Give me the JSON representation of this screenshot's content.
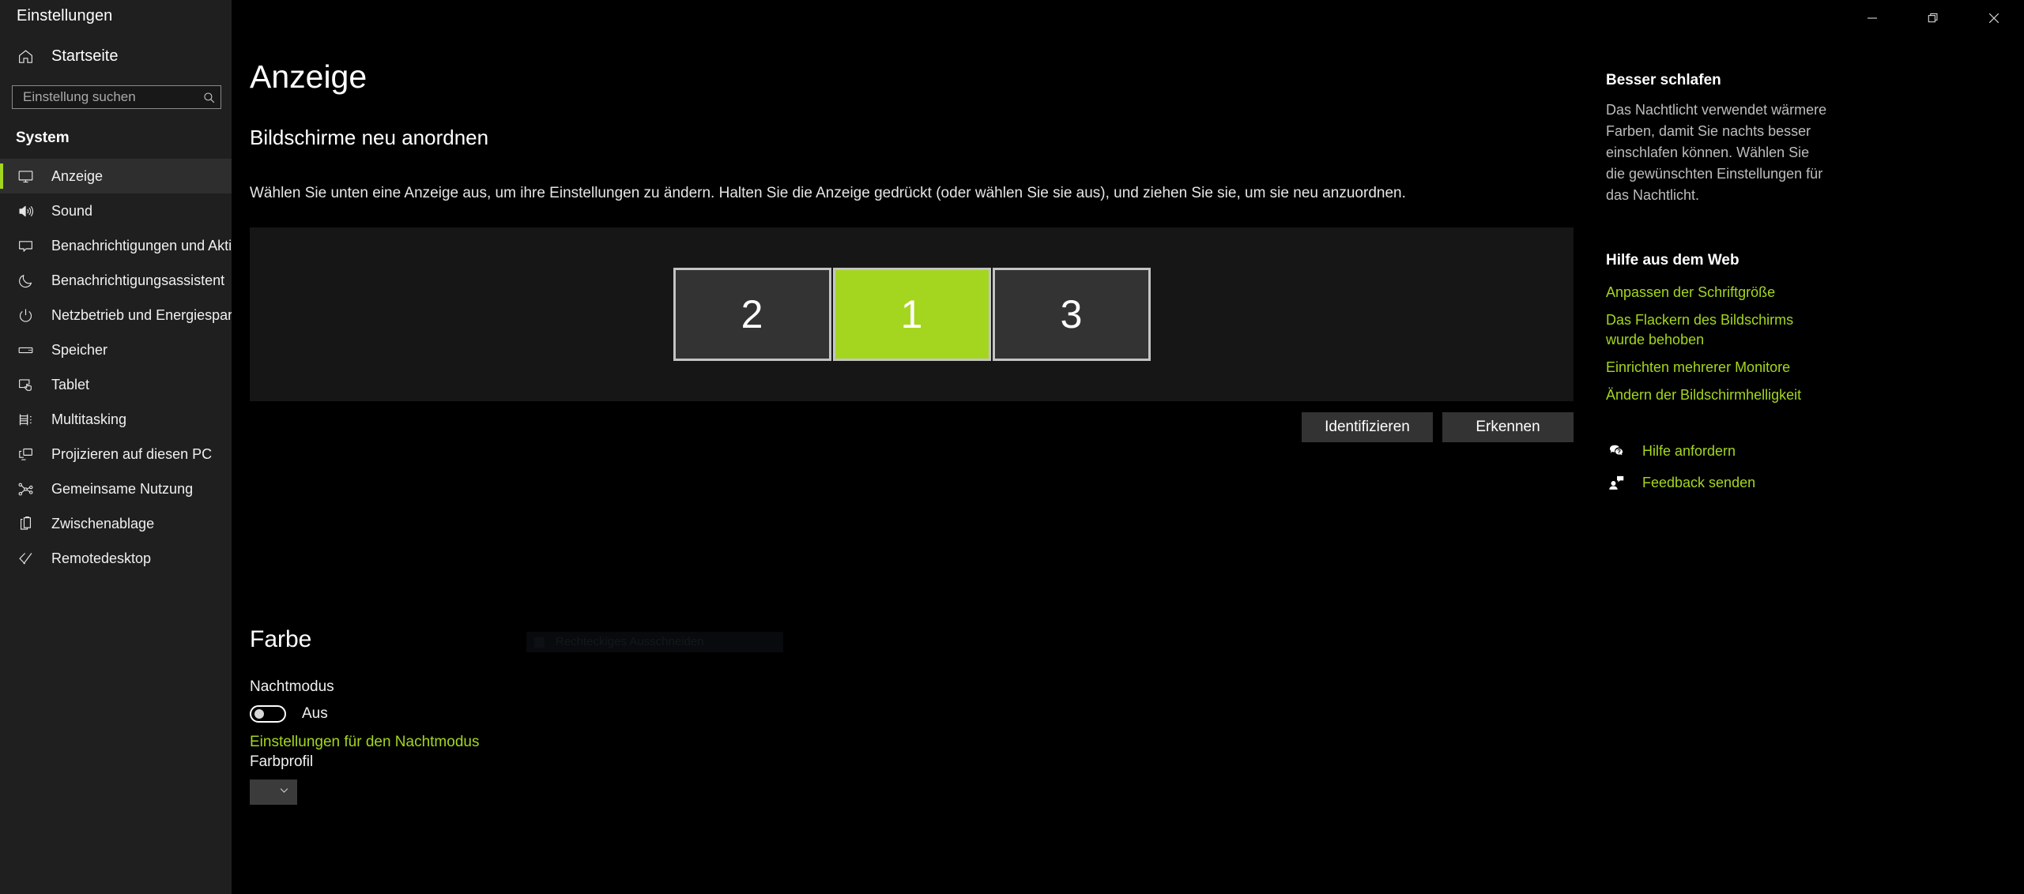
{
  "window": {
    "title": "Einstellungen",
    "controls": {
      "minimize": "minimize-icon",
      "maximize": "restore-icon",
      "close": "close-icon"
    }
  },
  "sidebar": {
    "home": {
      "label": "Startseite",
      "icon": "home-icon"
    },
    "search": {
      "placeholder": "Einstellung suchen",
      "value": "",
      "icon": "search-icon"
    },
    "group_title": "System",
    "items": [
      {
        "label": "Anzeige",
        "icon": "monitor-icon",
        "selected": true
      },
      {
        "label": "Sound",
        "icon": "speaker-icon",
        "selected": false
      },
      {
        "label": "Benachrichtigungen und Aktionen",
        "icon": "chat-bubble-icon",
        "selected": false
      },
      {
        "label": "Benachrichtigungsassistent",
        "icon": "moon-icon",
        "selected": false
      },
      {
        "label": "Netzbetrieb und Energiesparen",
        "icon": "power-icon",
        "selected": false
      },
      {
        "label": "Speicher",
        "icon": "drive-icon",
        "selected": false
      },
      {
        "label": "Tablet",
        "icon": "tablet-touch-icon",
        "selected": false
      },
      {
        "label": "Multitasking",
        "icon": "multitasking-icon",
        "selected": false
      },
      {
        "label": "Projizieren auf diesen PC",
        "icon": "project-screen-icon",
        "selected": false
      },
      {
        "label": "Gemeinsame Nutzung",
        "icon": "share-icon",
        "selected": false
      },
      {
        "label": "Zwischenablage",
        "icon": "clipboard-icon",
        "selected": false
      },
      {
        "label": "Remotedesktop",
        "icon": "remote-desktop-icon",
        "selected": false
      }
    ]
  },
  "main": {
    "page_title": "Anzeige",
    "rearrange": {
      "section_title": "Bildschirme neu anordnen",
      "description": "Wählen Sie unten eine Anzeige aus, um ihre Einstellungen zu ändern. Halten Sie die Anzeige gedrückt (oder wählen Sie sie aus), und ziehen Sie sie, um sie neu anzuordnen.",
      "monitors": [
        {
          "number": "2",
          "selected": false
        },
        {
          "number": "1",
          "selected": true
        },
        {
          "number": "3",
          "selected": false
        }
      ],
      "identify_button": "Identifizieren",
      "detect_button": "Erkennen"
    },
    "color": {
      "section_title": "Farbe",
      "night_mode_label": "Nachtmodus",
      "night_mode_state": "Aus",
      "night_mode_on": false,
      "night_mode_link": "Einstellungen für den Nachtmodus",
      "color_profile_label": "Farbprofil",
      "color_profile_value": ""
    },
    "snip_overlay": {
      "label": "Rechteckiges Ausschneiden"
    }
  },
  "right_panel": {
    "tip_heading": "Besser schlafen",
    "tip_body": "Das Nachtlicht verwendet wärmere Farben, damit Sie nachts besser einschlafen können. Wählen Sie die gewünschten Einstellungen für das Nachtlicht.",
    "web_help_heading": "Hilfe aus dem Web",
    "web_help_links": [
      "Anpassen der Schriftgröße",
      "Das Flackern des Bildschirms wurde behoben",
      "Einrichten mehrerer Monitore",
      "Ändern der Bildschirmhelligkeit"
    ],
    "actions": [
      {
        "label": "Hilfe anfordern",
        "icon": "help-chat-icon"
      },
      {
        "label": "Feedback senden",
        "icon": "feedback-person-icon"
      }
    ]
  },
  "colors": {
    "accent_green": "#a4d61f",
    "sidebar_bg": "#1f1f1f",
    "content_bg": "#000000",
    "panel_bg": "#161616",
    "tile_bg": "#333333",
    "tile_border": "#c4c4c4",
    "button_bg": "#333333"
  }
}
